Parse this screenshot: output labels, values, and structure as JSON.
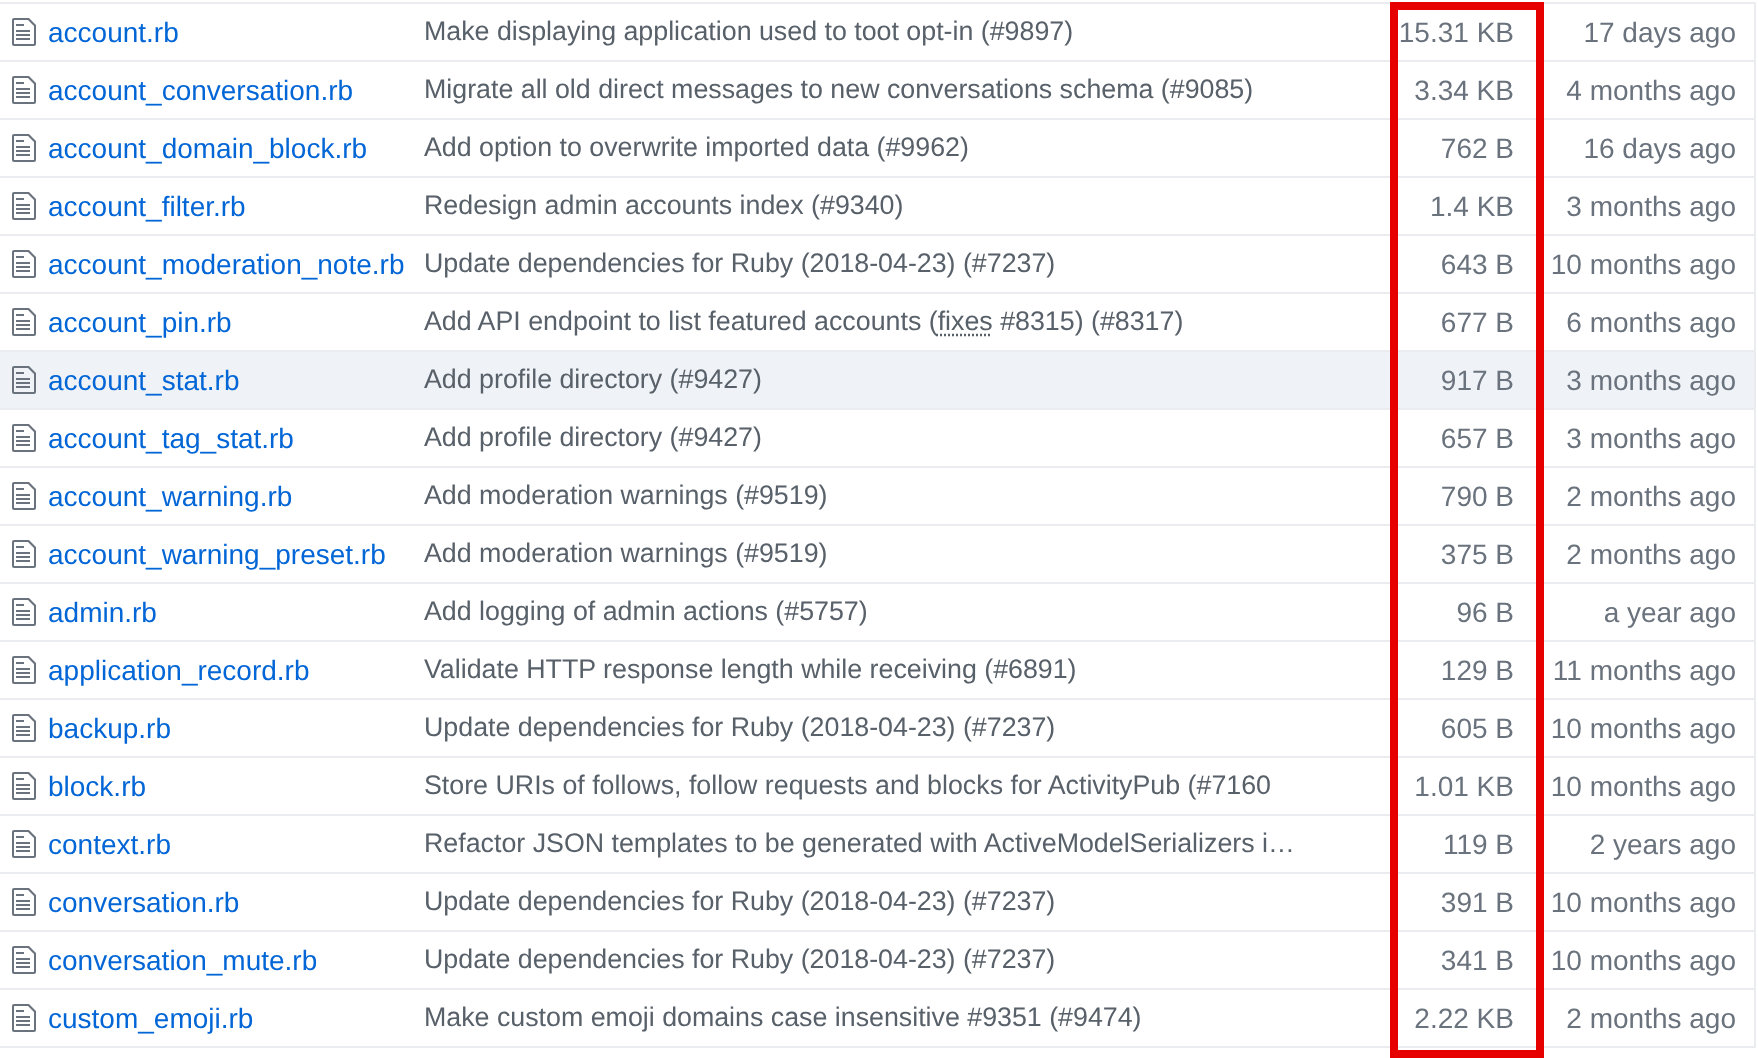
{
  "files": [
    {
      "name": "account.rb",
      "message": [
        {
          "kind": "text",
          "text": "Make displaying application used to toot opt-in (#9897)"
        }
      ],
      "size": "15.31 KB",
      "age": "17 days ago",
      "highlighted": false
    },
    {
      "name": "account_conversation.rb",
      "message": [
        {
          "kind": "text",
          "text": "Migrate all old direct messages to new conversations schema (#9085)"
        }
      ],
      "size": "3.34 KB",
      "age": "4 months ago",
      "highlighted": false
    },
    {
      "name": "account_domain_block.rb",
      "message": [
        {
          "kind": "text",
          "text": "Add option to overwrite imported data (#9962)"
        }
      ],
      "size": "762 B",
      "age": "16 days ago",
      "highlighted": false
    },
    {
      "name": "account_filter.rb",
      "message": [
        {
          "kind": "text",
          "text": "Redesign admin accounts index (#9340)"
        }
      ],
      "size": "1.4 KB",
      "age": "3 months ago",
      "highlighted": false
    },
    {
      "name": "account_moderation_note.rb",
      "message": [
        {
          "kind": "text",
          "text": "Update dependencies for Ruby (2018-04-23) (#7237)"
        }
      ],
      "size": "643 B",
      "age": "10 months ago",
      "highlighted": false
    },
    {
      "name": "account_pin.rb",
      "message": [
        {
          "kind": "text",
          "text": "Add API endpoint to list featured accounts ("
        },
        {
          "kind": "link",
          "text": "fixes"
        },
        {
          "kind": "text",
          "text": " #8315) (#8317)"
        }
      ],
      "size": "677 B",
      "age": "6 months ago",
      "highlighted": false
    },
    {
      "name": "account_stat.rb",
      "message": [
        {
          "kind": "text",
          "text": "Add profile directory (#9427)"
        }
      ],
      "size": "917 B",
      "age": "3 months ago",
      "highlighted": true
    },
    {
      "name": "account_tag_stat.rb",
      "message": [
        {
          "kind": "text",
          "text": "Add profile directory (#9427)"
        }
      ],
      "size": "657 B",
      "age": "3 months ago",
      "highlighted": false
    },
    {
      "name": "account_warning.rb",
      "message": [
        {
          "kind": "text",
          "text": "Add moderation warnings (#9519)"
        }
      ],
      "size": "790 B",
      "age": "2 months ago",
      "highlighted": false
    },
    {
      "name": "account_warning_preset.rb",
      "message": [
        {
          "kind": "text",
          "text": "Add moderation warnings (#9519)"
        }
      ],
      "size": "375 B",
      "age": "2 months ago",
      "highlighted": false
    },
    {
      "name": "admin.rb",
      "message": [
        {
          "kind": "text",
          "text": "Add logging of admin actions (#5757)"
        }
      ],
      "size": "96 B",
      "age": "a year ago",
      "highlighted": false
    },
    {
      "name": "application_record.rb",
      "message": [
        {
          "kind": "text",
          "text": "Validate HTTP response length while receiving (#6891)"
        }
      ],
      "size": "129 B",
      "age": "11 months ago",
      "highlighted": false
    },
    {
      "name": "backup.rb",
      "message": [
        {
          "kind": "text",
          "text": "Update dependencies for Ruby (2018-04-23) (#7237)"
        }
      ],
      "size": "605 B",
      "age": "10 months ago",
      "highlighted": false
    },
    {
      "name": "block.rb",
      "message": [
        {
          "kind": "text",
          "text": "Store URIs of follows, follow requests and blocks for ActivityPub (#7160"
        }
      ],
      "size": "1.01 KB",
      "age": "10 months ago",
      "highlighted": false
    },
    {
      "name": "context.rb",
      "message": [
        {
          "kind": "text",
          "text": "Refactor JSON templates to be generated with ActiveModelSerializers i…"
        }
      ],
      "size": "119 B",
      "age": "2 years ago",
      "highlighted": false
    },
    {
      "name": "conversation.rb",
      "message": [
        {
          "kind": "text",
          "text": "Update dependencies for Ruby (2018-04-23) (#7237)"
        }
      ],
      "size": "391 B",
      "age": "10 months ago",
      "highlighted": false
    },
    {
      "name": "conversation_mute.rb",
      "message": [
        {
          "kind": "text",
          "text": "Update dependencies for Ruby (2018-04-23) (#7237)"
        }
      ],
      "size": "341 B",
      "age": "10 months ago",
      "highlighted": false
    },
    {
      "name": "custom_emoji.rb",
      "message": [
        {
          "kind": "text",
          "text": "Make custom emoji domains case insensitive #9351 (#9474)"
        }
      ],
      "size": "2.22 KB",
      "age": "2 months ago",
      "highlighted": false
    }
  ],
  "outline": {
    "kind": "frame"
  }
}
